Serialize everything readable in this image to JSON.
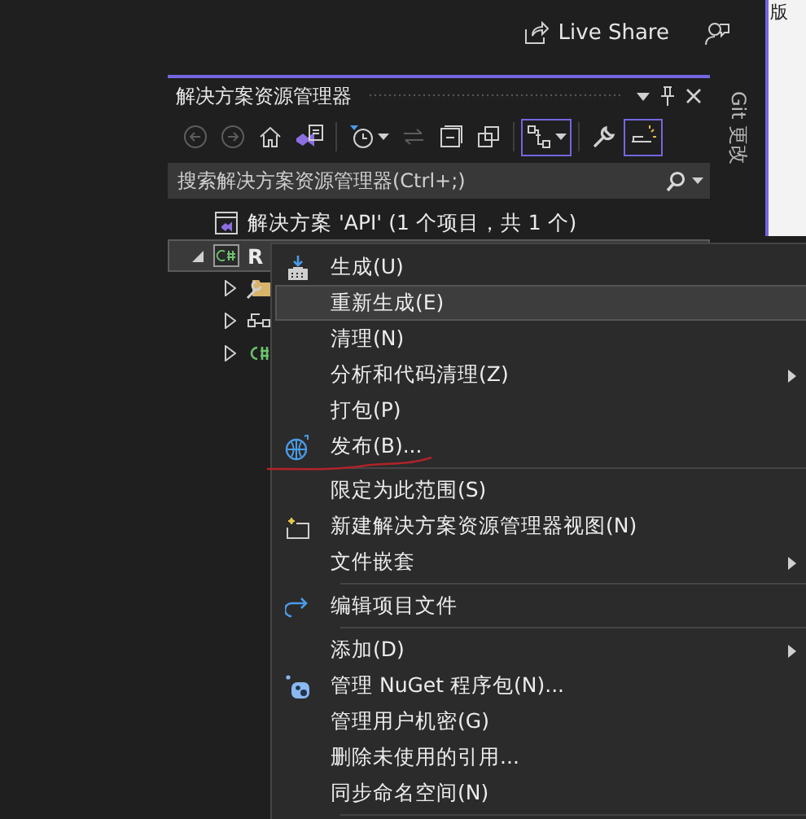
{
  "top_bar": {
    "live_share": "Live Share"
  },
  "side_window": {
    "text": "版"
  },
  "solution_explorer": {
    "title": "解决方案资源管理器",
    "toolbar": [
      {
        "disabled": true,
        "selected": false
      },
      {
        "disabled": true,
        "selected": false
      },
      {
        "disabled": false,
        "selected": false
      },
      {
        "disabled": false,
        "selected": false
      },
      {
        "disabled": false,
        "selected": false
      },
      {
        "disabled": true,
        "selected": false
      },
      {
        "disabled": false,
        "selected": false
      },
      {
        "disabled": false,
        "selected": false
      },
      {
        "disabled": false,
        "selected": true
      },
      {
        "disabled": false,
        "selected": false
      },
      {
        "disabled": false,
        "selected": true
      }
    ],
    "search": {
      "placeholder": "搜索解决方案资源管理器(Ctrl+;)"
    },
    "tree": [
      {
        "label": "解决方案 'API' (1 个项目，共 1 个)",
        "selected": false
      },
      {
        "label": "R",
        "selected": true,
        "expanded": true,
        "children": [
          {
            "selected": false,
            "expanded": false
          },
          {
            "selected": false,
            "expanded": false
          },
          {
            "selected": false,
            "expanded": false
          }
        ]
      }
    ]
  },
  "side_tabs": [
    {
      "label": "Git 更改"
    }
  ],
  "context_menu": {
    "items": [
      {
        "label": "生成(U)",
        "selected": false,
        "submenu": false,
        "separator_after": false
      },
      {
        "label": "重新生成(E)",
        "selected": true,
        "submenu": false,
        "separator_after": false
      },
      {
        "label": "清理(N)",
        "selected": false,
        "submenu": false,
        "separator_after": false
      },
      {
        "label": "分析和代码清理(Z)",
        "selected": false,
        "submenu": true,
        "separator_after": false
      },
      {
        "label": "打包(P)",
        "selected": false,
        "submenu": false,
        "separator_after": false
      },
      {
        "label": "发布(B)...",
        "selected": false,
        "submenu": false,
        "separator_after": true
      },
      {
        "label": "限定为此范围(S)",
        "selected": false,
        "submenu": false,
        "separator_after": false
      },
      {
        "label": "新建解决方案资源管理器视图(N)",
        "selected": false,
        "submenu": false,
        "separator_after": false
      },
      {
        "label": "文件嵌套",
        "selected": false,
        "submenu": true,
        "separator_after": true
      },
      {
        "label": "编辑项目文件",
        "selected": false,
        "submenu": false,
        "separator_after": true
      },
      {
        "label": "添加(D)",
        "selected": false,
        "submenu": true,
        "separator_after": false
      },
      {
        "label": "管理 NuGet 程序包(N)...",
        "selected": false,
        "submenu": false,
        "separator_after": false
      },
      {
        "label": "管理用户机密(G)",
        "selected": false,
        "submenu": false,
        "separator_after": false
      },
      {
        "label": "删除未使用的引用...",
        "selected": false,
        "submenu": false,
        "separator_after": false
      },
      {
        "label": "同步命名空间(N)",
        "selected": false,
        "submenu": false,
        "separator_after": true
      }
    ]
  },
  "annotation": {
    "kind": "underline",
    "color": "#b0232a"
  }
}
